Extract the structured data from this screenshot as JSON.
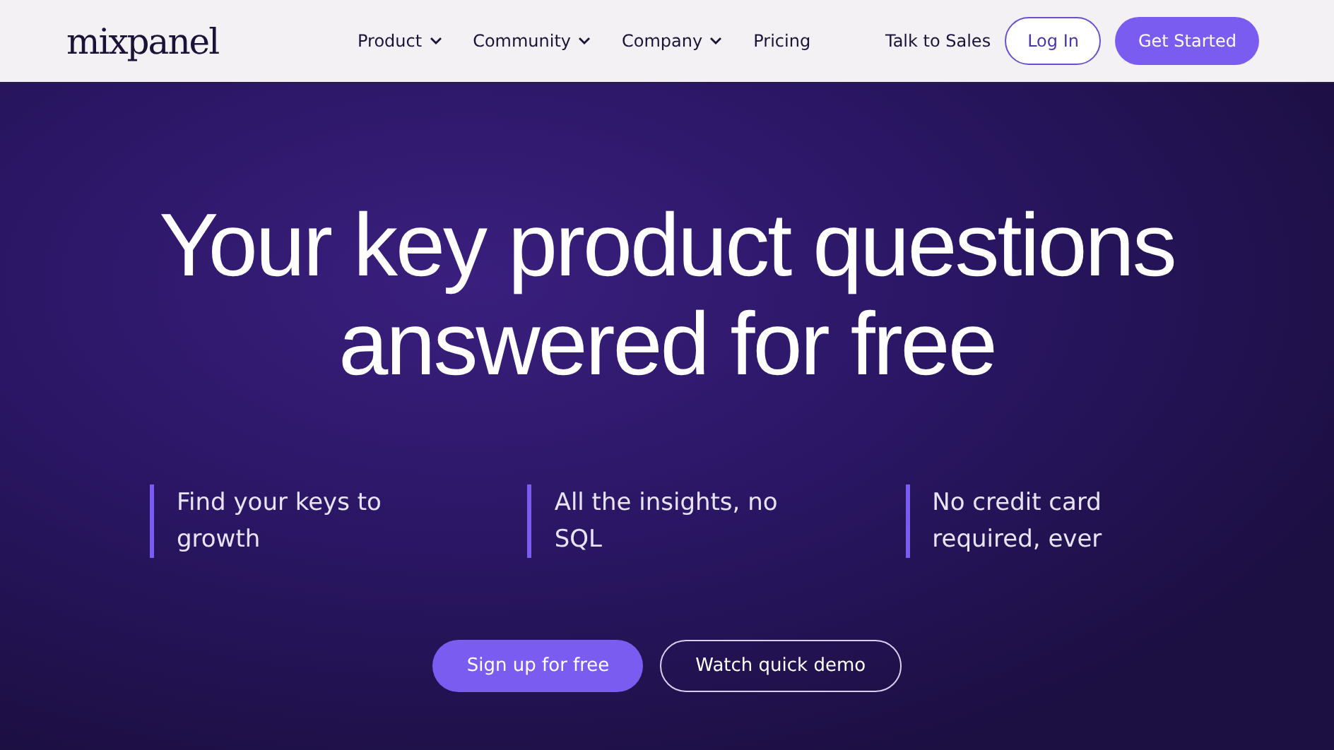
{
  "header": {
    "logo": "mixpanel",
    "nav": [
      {
        "label": "Product",
        "has_menu": true
      },
      {
        "label": "Community",
        "has_menu": true
      },
      {
        "label": "Company",
        "has_menu": true
      },
      {
        "label": "Pricing",
        "has_menu": false
      }
    ],
    "actions": [
      {
        "label": "Talk to Sales",
        "kind": "link"
      },
      {
        "label": "Log In",
        "kind": "outline"
      },
      {
        "label": "Get Started",
        "kind": "filled"
      }
    ]
  },
  "hero": {
    "headline": "Your key product questions answered for free",
    "features": [
      "Find your keys to growth",
      "All the insights, no SQL",
      "No credit card required, ever"
    ],
    "buttons": [
      {
        "label": "Sign up for free",
        "kind": "filled"
      },
      {
        "label": "Watch quick demo",
        "kind": "outline"
      }
    ]
  }
}
